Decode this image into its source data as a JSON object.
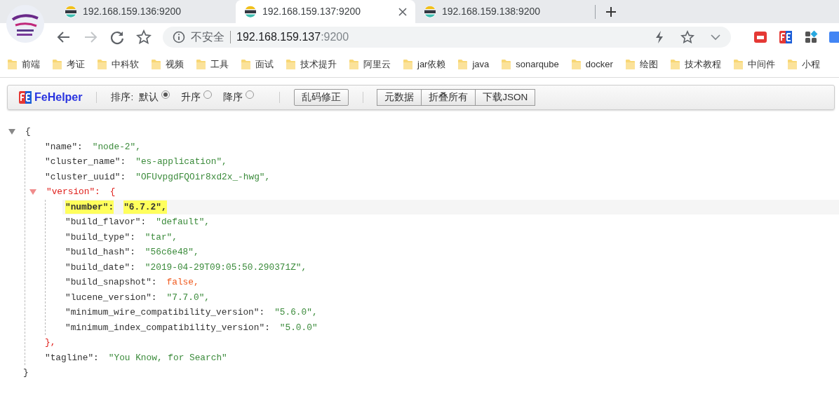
{
  "tabs": [
    {
      "title": "192.168.159.136:9200",
      "selected": false
    },
    {
      "title": "192.168.159.137:9200",
      "selected": true
    },
    {
      "title": "192.168.159.138:9200",
      "selected": false
    }
  ],
  "address_bar": {
    "security": "不安全",
    "host": "192.168.159.137",
    "port": ":9200"
  },
  "bookmarks": [
    "前端",
    "考证",
    "中科软",
    "视频",
    "工具",
    "面试",
    "技术提升",
    "阿里云",
    "jar依赖",
    "java",
    "sonarqube",
    "docker",
    "绘图",
    "技术教程",
    "中间件",
    "小程"
  ],
  "fehelper": {
    "brand": "FeHelper",
    "sort_label": "排序:",
    "sort_options": [
      {
        "label": "默认",
        "selected": true
      },
      {
        "label": "升序",
        "selected": false
      },
      {
        "label": "降序",
        "selected": false
      }
    ],
    "fix_button": "乱码修正",
    "buttons": [
      "元数据",
      "折叠所有",
      "下载JSON"
    ]
  },
  "json_view": {
    "open": "{",
    "close": "}",
    "expanded": true,
    "entries": [
      {
        "kind": "string",
        "key": "\"name\":",
        "value": "\"node-2\",",
        "selected": false
      },
      {
        "kind": "string",
        "key": "\"cluster_name\":",
        "value": "\"es-application\",",
        "selected": false
      },
      {
        "kind": "string",
        "key": "\"cluster_uuid\":",
        "value": "\"OFUvpgdFQOir8xd2x_-hwg\",",
        "selected": false
      },
      {
        "kind": "object",
        "key": "\"version\":",
        "open": "{",
        "close": "},",
        "expanded": true,
        "selected": false,
        "children": [
          {
            "kind": "string",
            "key": "\"number\":",
            "value": "\"6.7.2\",",
            "selected": true
          },
          {
            "kind": "string",
            "key": "\"build_flavor\":",
            "value": "\"default\",",
            "selected": false
          },
          {
            "kind": "string",
            "key": "\"build_type\":",
            "value": "\"tar\",",
            "selected": false
          },
          {
            "kind": "string",
            "key": "\"build_hash\":",
            "value": "\"56c6e48\",",
            "selected": false
          },
          {
            "kind": "string",
            "key": "\"build_date\":",
            "value": "\"2019-04-29T09:05:50.290371Z\",",
            "selected": false
          },
          {
            "kind": "literal",
            "key": "\"build_snapshot\":",
            "value": "false,",
            "selected": false
          },
          {
            "kind": "string",
            "key": "\"lucene_version\":",
            "value": "\"7.7.0\",",
            "selected": false
          },
          {
            "kind": "string",
            "key": "\"minimum_wire_compatibility_version\":",
            "value": "\"5.6.0\",",
            "selected": false
          },
          {
            "kind": "string",
            "key": "\"minimum_index_compatibility_version\":",
            "value": "\"5.0.0\"",
            "selected": false
          }
        ]
      },
      {
        "kind": "string",
        "key": "\"tagline\":",
        "value": "\"You Know, for Search\"",
        "selected": false
      }
    ]
  }
}
